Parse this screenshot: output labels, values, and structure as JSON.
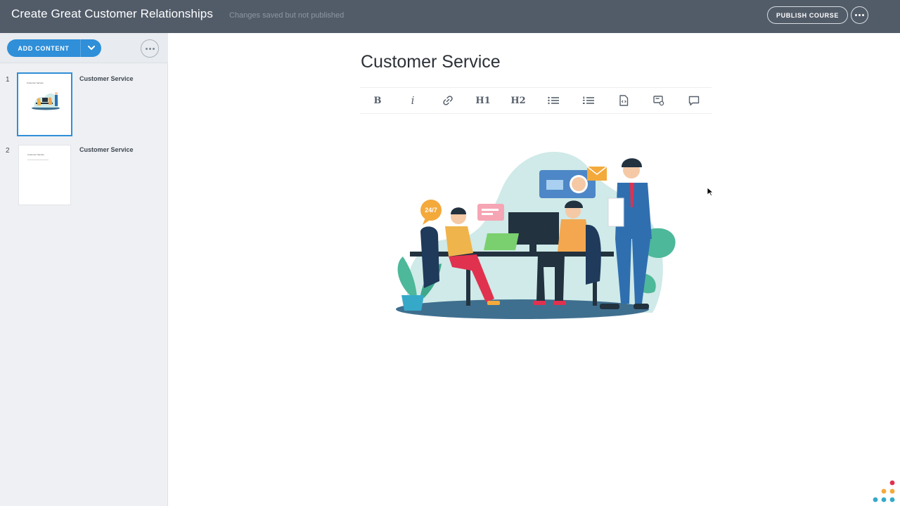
{
  "header": {
    "course_title": "Create Great Customer Relationships",
    "save_status": "Changes saved but not published",
    "publish_label": "PUBLISH COURSE",
    "more_icon": "more-horizontal-icon"
  },
  "sidebar": {
    "add_content_label": "ADD CONTENT",
    "add_caret_icon": "chevron-down-icon",
    "more_icon": "more-horizontal-icon",
    "pages": [
      {
        "number": "1",
        "label": "Customer Service",
        "thumb_title": "Customer Service",
        "selected": true
      },
      {
        "number": "2",
        "label": "Customer Service",
        "thumb_title": "Customer Service",
        "selected": false
      }
    ]
  },
  "editor": {
    "page_title": "Customer Service",
    "toolbar": {
      "bold": "B",
      "italic": "i",
      "link_icon": "link-icon",
      "h1": "H1",
      "h2": "H2",
      "bullet_list_icon": "bullet-list-icon",
      "numbered_list_icon": "numbered-list-icon",
      "code_icon": "code-file-icon",
      "embed_icon": "embed-icon",
      "comment_icon": "comment-icon"
    },
    "image": "customer-service-illustration"
  },
  "colors": {
    "topbar": "#525c69",
    "accent": "#2f8fd8",
    "sidebar": "#eef0f3"
  }
}
